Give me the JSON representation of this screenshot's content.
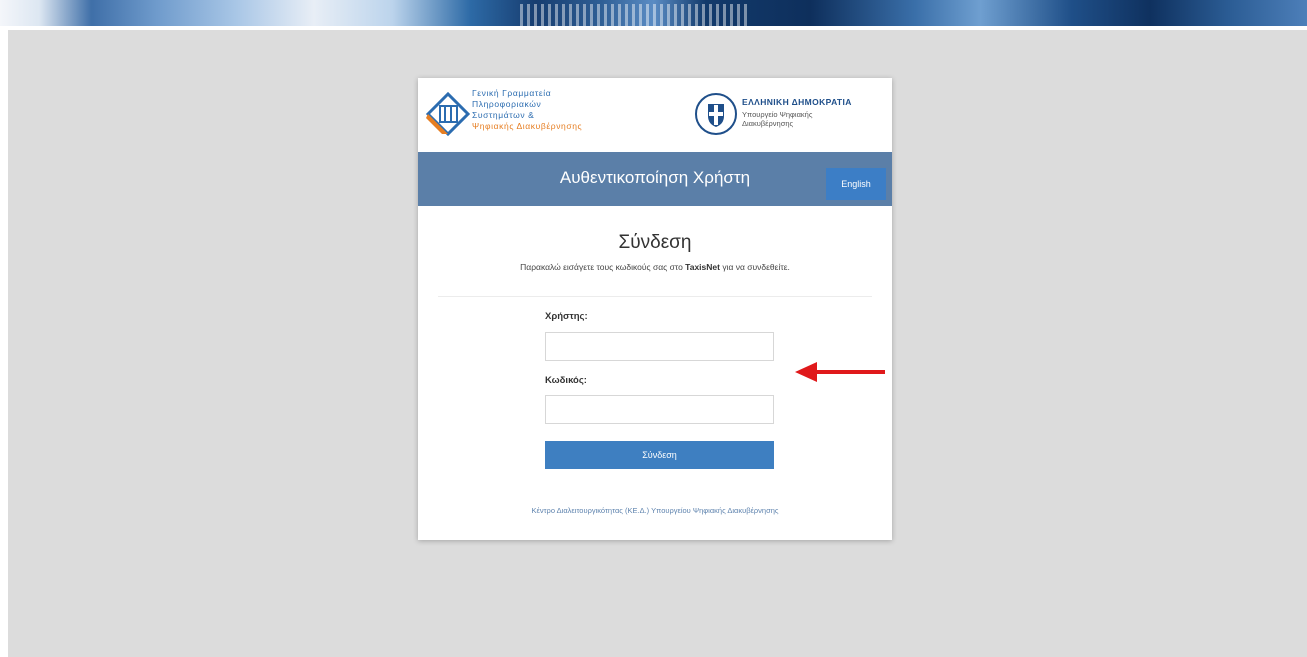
{
  "banner": {
    "name": "top-banner"
  },
  "logos": {
    "gsis_lines": [
      "Γενική Γραμματεία",
      "Πληροφοριακών",
      "Συστημάτων &",
      "Ψηφιακής Διακυβέρνησης"
    ],
    "gov_title": "ΕΛΛΗΝΙΚΗ ΔΗΜΟΚΡΑΤΙΑ",
    "gov_sub_1": "Υπουργείο Ψηφιακής",
    "gov_sub_2": "Διακυβέρνησης"
  },
  "header": {
    "title": "Αυθεντικοποίηση Χρήστη",
    "lang_label": "English"
  },
  "login": {
    "heading": "Σύνδεση",
    "subtitle_pre": "Παρακαλώ εισάγετε τους κωδικούς σας στο ",
    "subtitle_bold": "TaxisNet",
    "subtitle_post": " για να συνδεθείτε."
  },
  "form": {
    "user_label": "Χρήστης:",
    "user_value": "",
    "password_label": "Κωδικός:",
    "password_value": "",
    "submit_label": "Σύνδεση"
  },
  "footer": {
    "link_text": "Κέντρο Διαλειτουργικότητας (ΚΕ.Δ.) Υπουργείου Ψηφιακής Διακυβέρνησης"
  },
  "colors": {
    "header_bar": "#5b7fa8",
    "primary_button": "#3e7fc1",
    "annotation_arrow": "#e0191b"
  }
}
